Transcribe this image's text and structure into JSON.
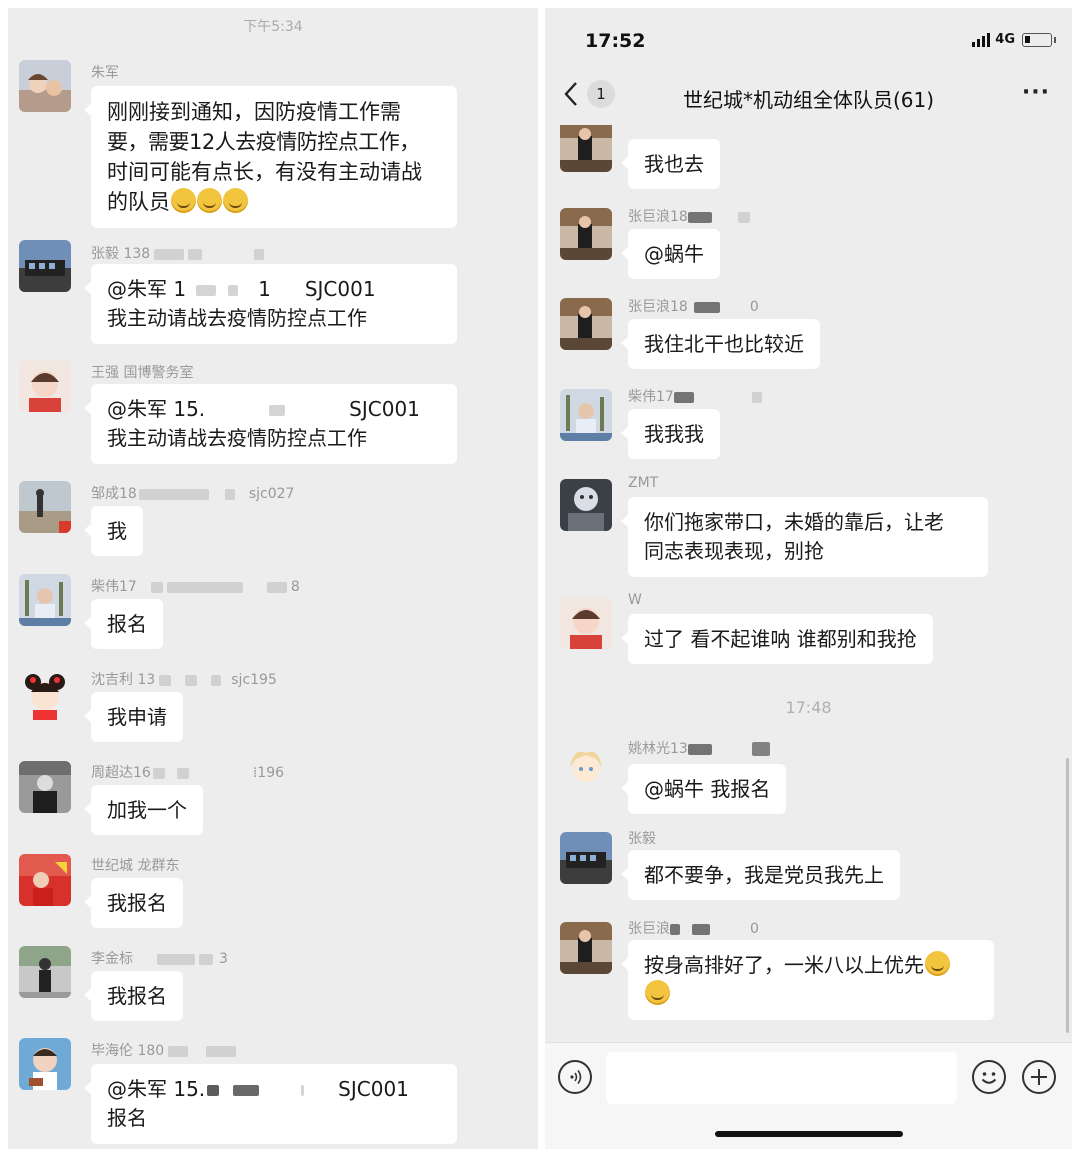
{
  "left": {
    "timestamp": "下午5:34",
    "messages": [
      {
        "sender": "朱军",
        "text": [
          "刚刚接到通知，因防疫情工作需",
          "要，需要12人去疫情防控点工作，",
          "时间可能有点长，有没有主动请战",
          "的队员"
        ]
      },
      {
        "sender": "张毅 138",
        "sender_tail": "",
        "text_a": "@朱军 1",
        "text_a2": "1",
        "text_a3": "SJC001",
        "text_b": "我主动请战去疫情防控点工作"
      },
      {
        "sender": "王强 国博警务室",
        "text_a": "@朱军 15.",
        "text_a3": "SJC001",
        "text_b": "我主动请战去疫情防控点工作"
      },
      {
        "sender": "邹成18",
        "sender_tail": "sjc027",
        "text": "我"
      },
      {
        "sender": "柴伟17",
        "sender_tail": "8",
        "text": "报名"
      },
      {
        "sender": "沈吉利 13",
        "sender_tail": "sjc195",
        "text": "我申请"
      },
      {
        "sender": "周超达16",
        "sender_tail": "196",
        "text": "加我一个"
      },
      {
        "sender": "世纪城 龙群东",
        "text": "我报名"
      },
      {
        "sender": "李金标",
        "sender_tail": "3",
        "text": "我报名"
      },
      {
        "sender": "毕海伦 180",
        "text_a": "@朱军 15.",
        "text_a3": "SJC001",
        "text_b": "报名"
      }
    ]
  },
  "right": {
    "status": {
      "time": "17:52",
      "network": "4G"
    },
    "header": {
      "back_badge": "1",
      "title": "世纪城*机动组全体队员(61)",
      "more": "···"
    },
    "messages": [
      {
        "sender": "",
        "text": "我也去"
      },
      {
        "sender": "张巨浪18",
        "text": "@蜗牛"
      },
      {
        "sender": "张巨浪18",
        "sender_tail": "0",
        "text": "我住北干也比较近"
      },
      {
        "sender": "柴伟17",
        "text": "我我我"
      },
      {
        "sender": "ZMT",
        "text": [
          "你们拖家带口，未婚的靠后，让老",
          "同志表现表现，别抢"
        ]
      },
      {
        "sender": "W",
        "text": "过了 看不起谁呐 谁都别和我抢"
      },
      {
        "sender": "姚林光13",
        "text": "@蜗牛 我报名"
      },
      {
        "sender": "张毅",
        "text": "都不要争，我是党员我先上"
      },
      {
        "sender": "张巨浪",
        "sender_tail": "0",
        "text": [
          "按身高排好了，一米八以上优先",
          ""
        ]
      }
    ],
    "divider_time": "17:48"
  },
  "colors": {
    "panel_bg": "#ededed",
    "bubble": "#ffffff",
    "name": "#999999"
  }
}
